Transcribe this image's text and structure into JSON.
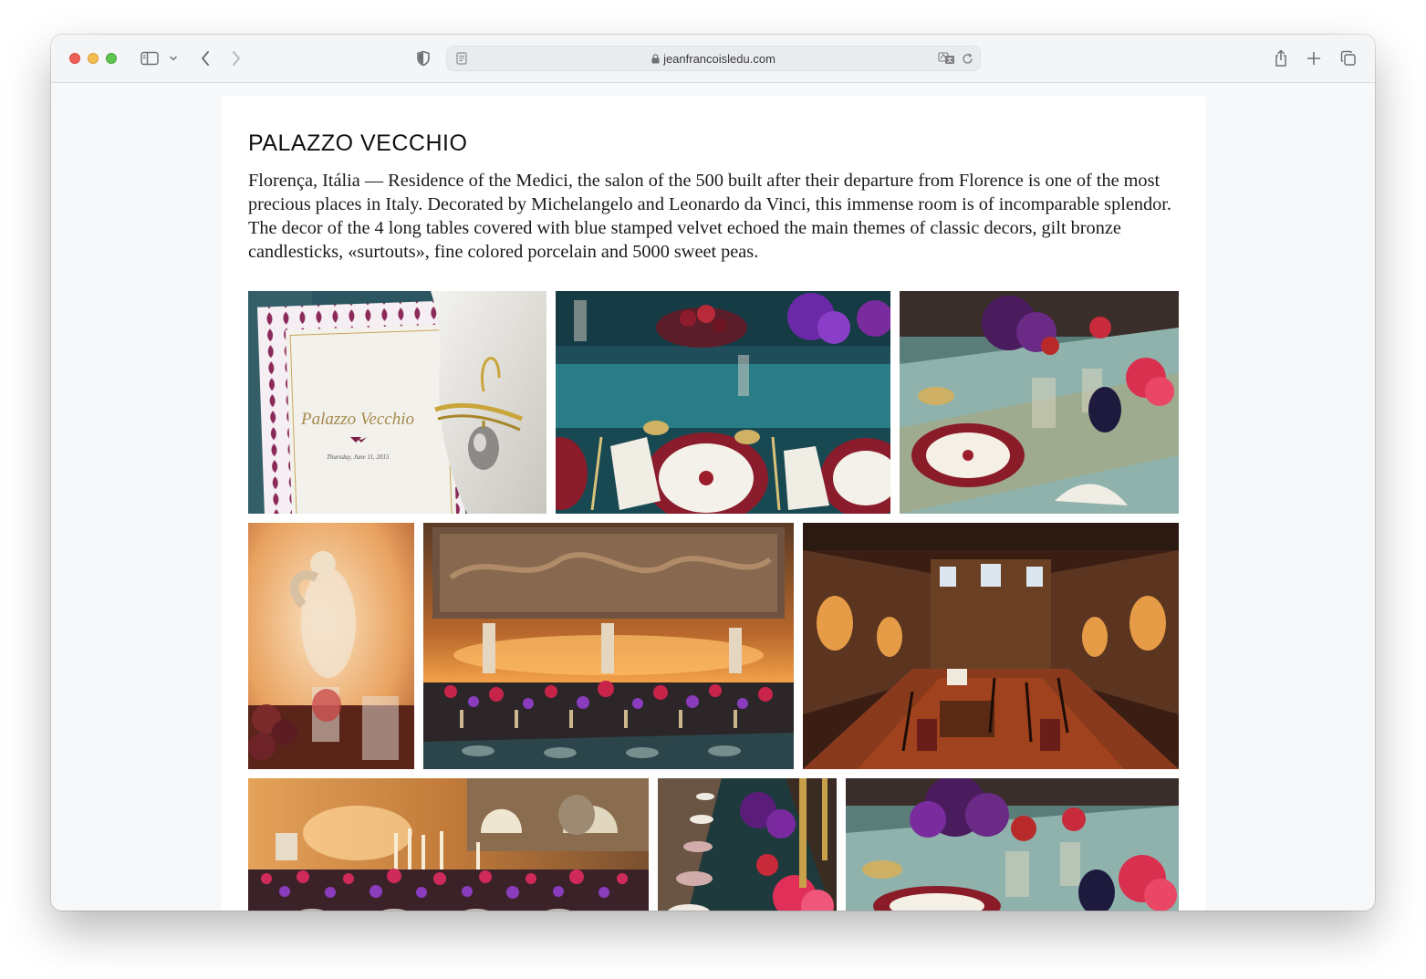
{
  "browser": {
    "url": "jeanfrancoisledu.com",
    "icons": {
      "close": "close-window-icon",
      "minimize": "minimize-window-icon",
      "zoom": "zoom-window-icon",
      "sidebar": "sidebar-icon",
      "back": "back-arrow-icon",
      "forward": "forward-arrow-icon",
      "privacy": "shield-icon",
      "reader": "reader-icon",
      "lock": "lock-icon",
      "translate": "translate-icon",
      "reload": "reload-icon",
      "share": "share-icon",
      "new_tab": "plus-icon",
      "tabs": "tab-overview-icon"
    }
  },
  "page": {
    "title": "PALAZZO VECCHIO",
    "description": "Florença, Itália — Residence of the Medici, the salon of the 500 built after their departure from Florence is one of the most precious places in Italy. Decorated by Michelangelo and Leonardo da Vinci, this immense room is of incomparable splendor. The decor of the 4 long tables covered with blue stamped velvet echoed the main themes of classic decors, gilt bronze candlesticks, «surtouts», fine colored porcelain and 5000 sweet peas.",
    "gallery": [
      {
        "name": "menu-card-photo",
        "menu_title": "Palazzo Vecchio",
        "menu_date": "Thursday, June 11, 2015"
      },
      {
        "name": "place-setting-photo"
      },
      {
        "name": "table-centerpiece-photo"
      },
      {
        "name": "statue-glassware-photo"
      },
      {
        "name": "banquet-hall-photo"
      },
      {
        "name": "salon-musicians-photo"
      },
      {
        "name": "hall-candles-photo"
      },
      {
        "name": "long-table-photo"
      },
      {
        "name": "flowers-detail-photo"
      }
    ]
  }
}
